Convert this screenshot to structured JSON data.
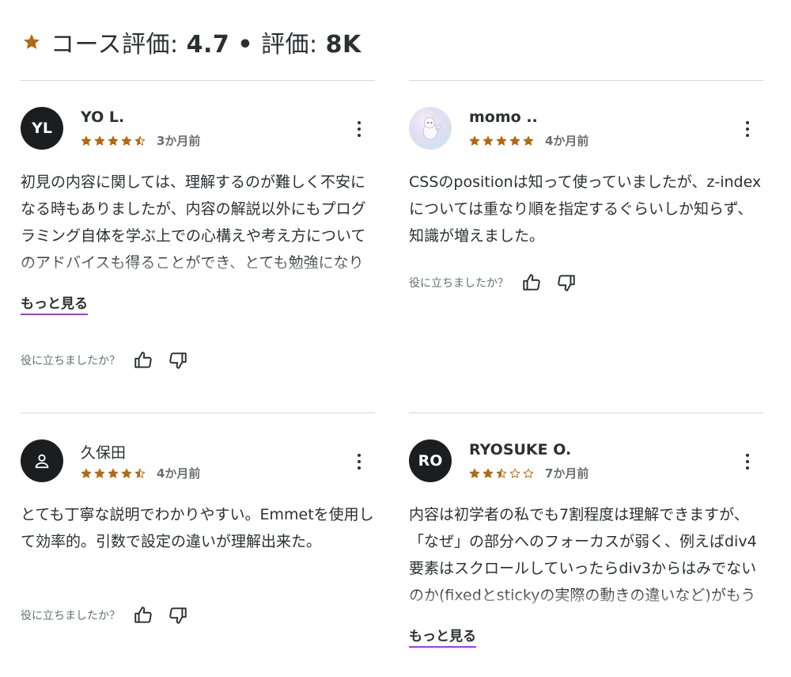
{
  "header": {
    "prefix": "コース評価: ",
    "rating": "4.7",
    "separator": "•",
    "count_label": "評価: ",
    "count": "8K",
    "accent": "#b4690e"
  },
  "helpful_question": "役に立ちましたか？",
  "more_label": "もっと見る",
  "reviews": [
    {
      "initials": "YL",
      "name": "YO L.",
      "rating": 4.5,
      "when": "3か月前",
      "text": "初見の内容に関しては、理解するのが難しく不安になる時もありましたが、内容の解説以外にもプログラミング自体を学ぶ上での心構えや考え方についてのアドバイスも得ることができ、とても勉強になりました。"
    },
    {
      "initials": "",
      "name": "momo ..",
      "rating": 5,
      "when": "4か月前",
      "text": "CSSのpositionは知って使っていましたが、z-indexについては重なり順を指定するぐらいしか知らず、知識が増えました。"
    },
    {
      "initials": "",
      "name": "久保田",
      "rating": 4.5,
      "when": "4か月前",
      "text": "とても丁寧な説明でわかりやすい。Emmetを使用して効率的。引数で設定の違いが理解出来た。"
    },
    {
      "initials": "RO",
      "name": "RYOSUKE O.",
      "rating": 2.5,
      "when": "7か月前",
      "text": "内容は初学者の私でも7割程度は理解できますが、「なぜ」の部分へのフォーカスが弱く、例えばdiv4要素はスクロールしていったらdiv3からはみでないのか(fixedとstickyの実際の動きの違いなど)がもう少し知りたかった。"
    }
  ]
}
